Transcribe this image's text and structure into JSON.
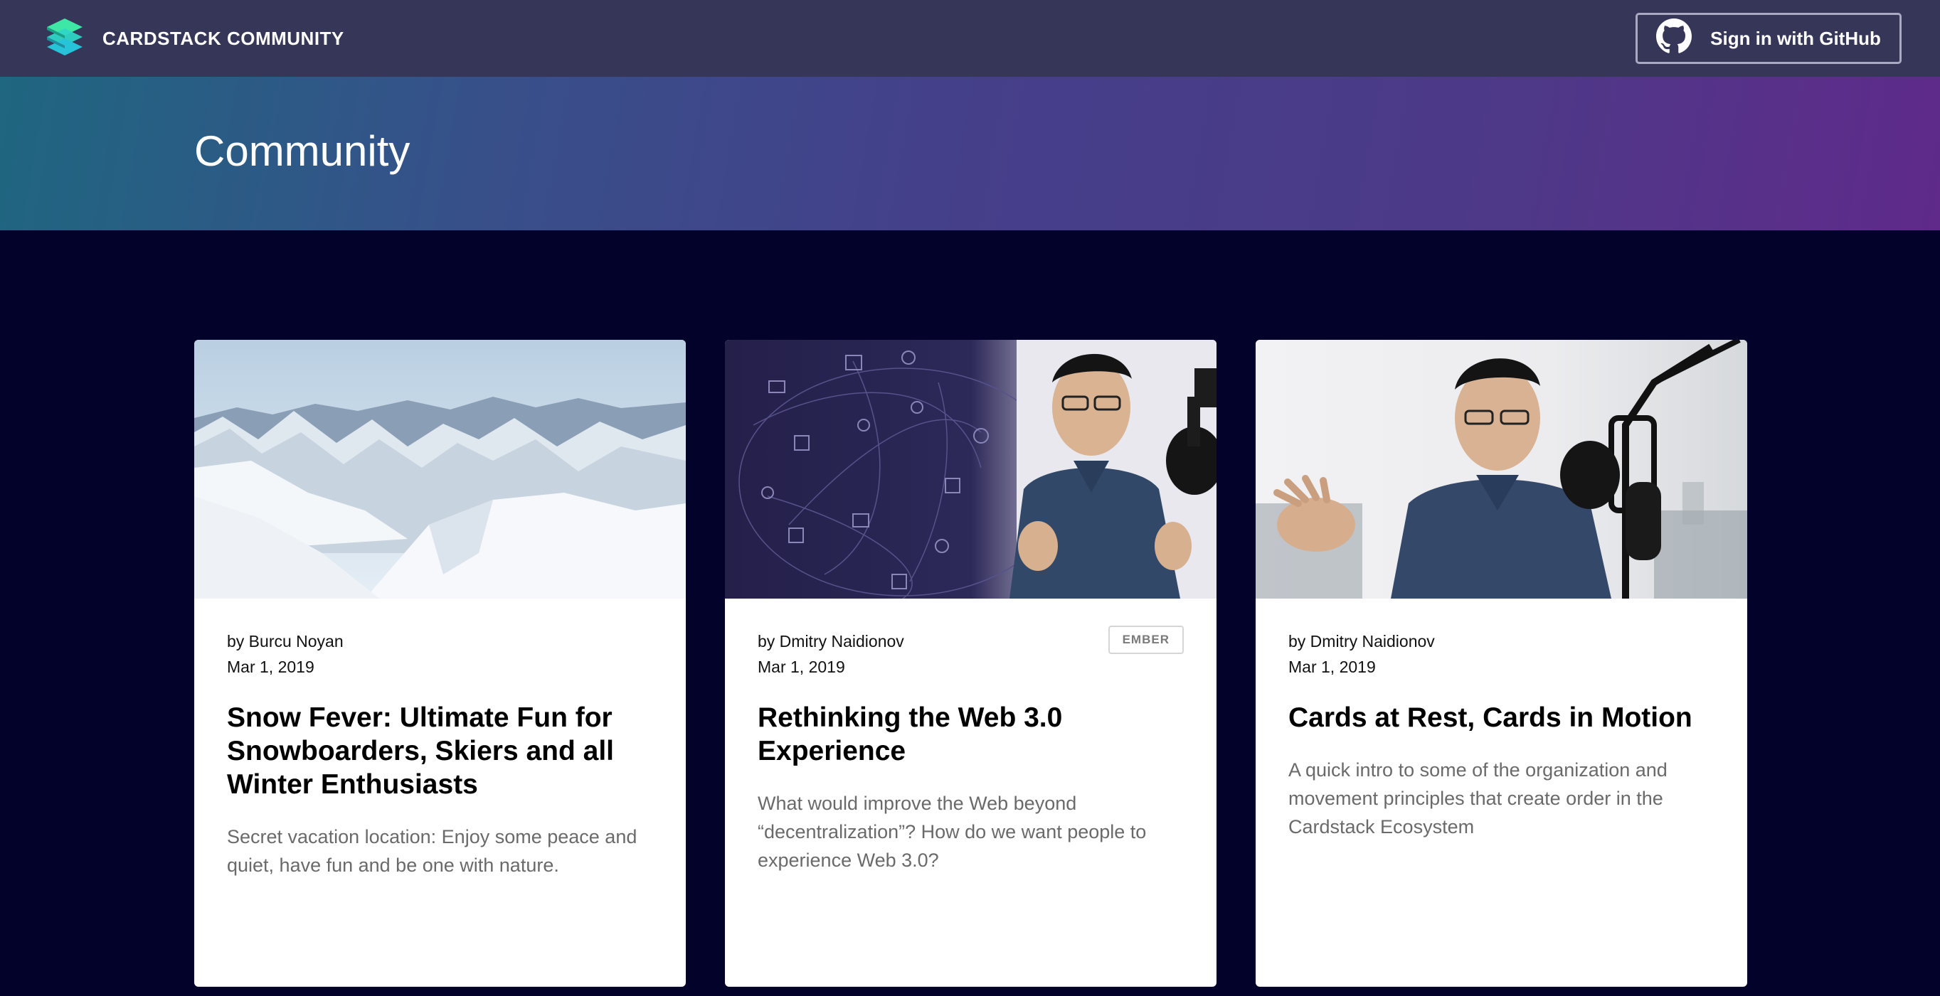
{
  "header": {
    "brand": "CARDSTACK COMMUNITY",
    "signin_label": "Sign in with GitHub",
    "logo_icon": "cardstack-logo-icon",
    "github_icon": "github-icon"
  },
  "hero": {
    "title": "Community"
  },
  "cards": [
    {
      "byline": "by Burcu Noyan",
      "date": "Mar 1, 2019",
      "title": "Snow Fever: Ultimate Fun for Snowboarders, Skiers and all Winter Enthusiasts",
      "description": "Secret vacation location: Enjoy some peace and quiet, have fun and be one with nature.",
      "image": "snowy-mountains-photo"
    },
    {
      "byline": "by Dmitry Naidionov",
      "date": "Mar 1, 2019",
      "tag": "EMBER",
      "title": "Rethinking the Web 3.0 Experience",
      "description": "What would improve the Web beyond “decentralization”? How do we want people to experience Web 3.0?",
      "image": "speaker-with-network-diagram-photo"
    },
    {
      "byline": "by Dmitry Naidionov",
      "date": "Mar 1, 2019",
      "title": "Cards at Rest, Cards in Motion",
      "description": "A quick intro to some of the organization and movement principles that create order in the Cardstack Ecosystem",
      "image": "speaker-with-microphone-photo"
    }
  ],
  "colors": {
    "page_bg": "#03022a",
    "topbar_bg": "#363659",
    "accent_teal": "#2ee6c5"
  }
}
